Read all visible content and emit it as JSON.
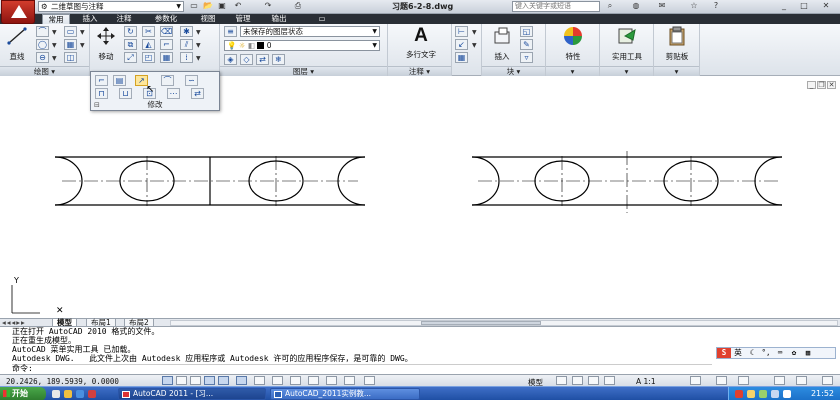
{
  "titlebar": {
    "workspace": "二维草图与注释",
    "document_title": "习题6-2-8.dwg",
    "search_placeholder": "键入关键字或短语",
    "qa_icons": [
      "new-icon",
      "open-icon",
      "save-icon",
      "undo-icon",
      "redo-icon",
      "plot-icon"
    ]
  },
  "tabs": [
    "常用",
    "插入",
    "注释",
    "参数化",
    "视图",
    "管理",
    "输出"
  ],
  "ribbon": {
    "draw_panel": {
      "line_label": "直线",
      "label": "绘图"
    },
    "modify_panel": {
      "move_label": "移动",
      "label": "修改"
    },
    "layers_panel": {
      "layer_state": "未保存的图层状态",
      "current_layer": "0",
      "label": "图层"
    },
    "annotation_panel": {
      "text_label": "多行文字",
      "label": "注释"
    },
    "block_panel": {
      "insert_label": "插入",
      "label": "块"
    },
    "properties_label": "特性",
    "utilities_label": "实用工具",
    "clipboard_label": "剪贴板"
  },
  "layout_tabs": [
    "模型",
    "布局1",
    "布局2"
  ],
  "command_lines": [
    "正在打开 AutoCAD 2010 格式的文件。",
    "正在重生成模型。",
    "AutoCAD 菜单实用工具 已加载。",
    "Autodesk DWG.   此文件上次由 Autodesk 应用程序或 Autodesk 许可的应用程序保存，是可靠的 DWG。",
    "命令:"
  ],
  "ime_label": "英",
  "status": {
    "coords": "20.2426, 189.5939, 0.0000",
    "model_label": "模型",
    "scale_label": "A 1:1"
  },
  "taskbar": {
    "start_label": "开始",
    "tasks": [
      "AutoCAD 2011 - [习...",
      "AutoCAD_2011实例教..."
    ],
    "clock": "21:52"
  }
}
